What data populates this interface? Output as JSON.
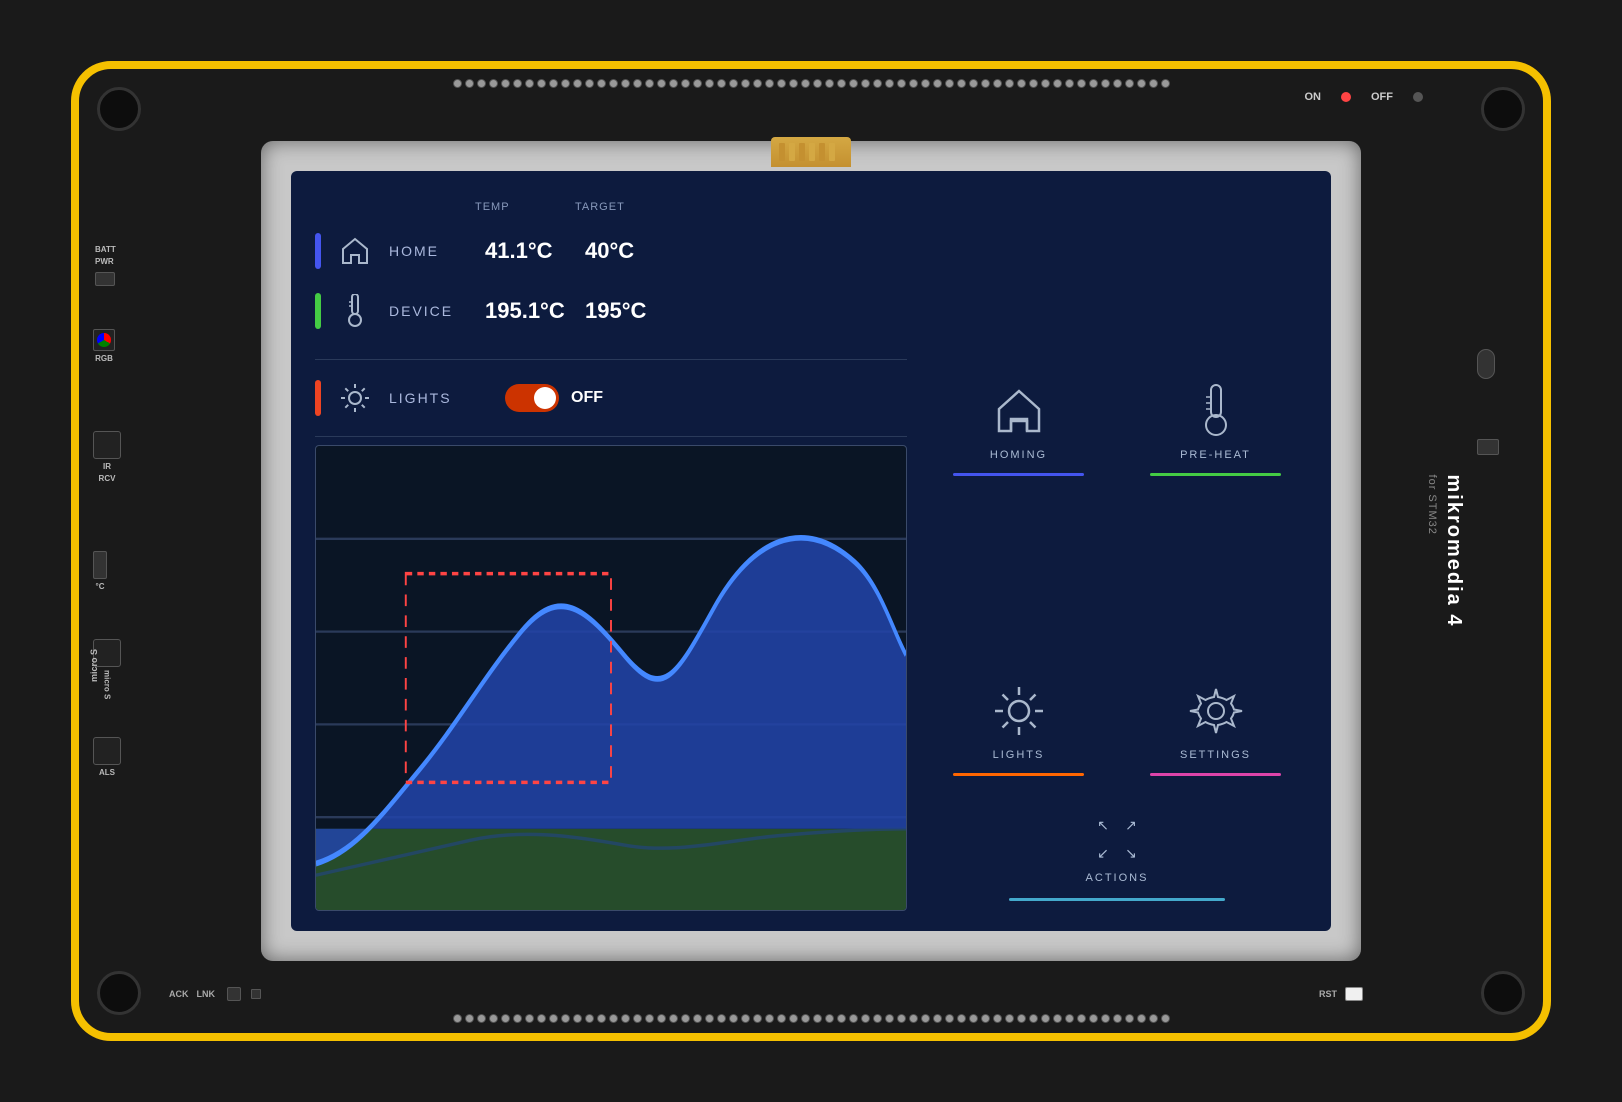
{
  "board": {
    "brand": "mikromedia 4",
    "brand_sub": "for STM32",
    "onoff": {
      "on_label": "ON",
      "off_label": "OFF"
    }
  },
  "screen": {
    "temp_col": "TEMP",
    "target_col": "TARGET",
    "sensors": [
      {
        "name": "HOME",
        "color": "blue",
        "icon": "house",
        "temp": "41.1°C",
        "target": "40°C"
      },
      {
        "name": "DEVICE",
        "color": "green",
        "icon": "thermometer",
        "temp": "195.1°C",
        "target": "195°C"
      }
    ],
    "lights": {
      "name": "LIGHTS",
      "state": "OFF",
      "toggle_state": "off"
    },
    "nav_buttons": [
      {
        "label": "HOMING",
        "icon": "house",
        "underline": "blue"
      },
      {
        "label": "PRE-HEAT",
        "icon": "thermometer",
        "underline": "green"
      },
      {
        "label": "LIGHTS",
        "icon": "sun",
        "underline": "orange"
      },
      {
        "label": "SETTINGS",
        "icon": "gear",
        "underline": "pink"
      }
    ],
    "actions": {
      "label": "ACTIONS",
      "underline": "cyan"
    }
  },
  "labels": {
    "batt": "BATT",
    "pwr": "PWR",
    "rgb": "RGB",
    "ir_rcv": "IR\nRCV",
    "micro_sd": "micro S",
    "als": "ALS",
    "ack": "ACK",
    "lnk": "LNK",
    "rst": "RST"
  },
  "colors": {
    "pcb_bg": "#1a1a1a",
    "pcb_border": "#f5c000",
    "screen_bg": "#0d1b3e",
    "blue_accent": "#4455ee",
    "green_accent": "#44cc44",
    "red_accent": "#ee4422",
    "orange_accent": "#ff6600",
    "pink_accent": "#dd44aa",
    "cyan_accent": "#44aacc"
  }
}
